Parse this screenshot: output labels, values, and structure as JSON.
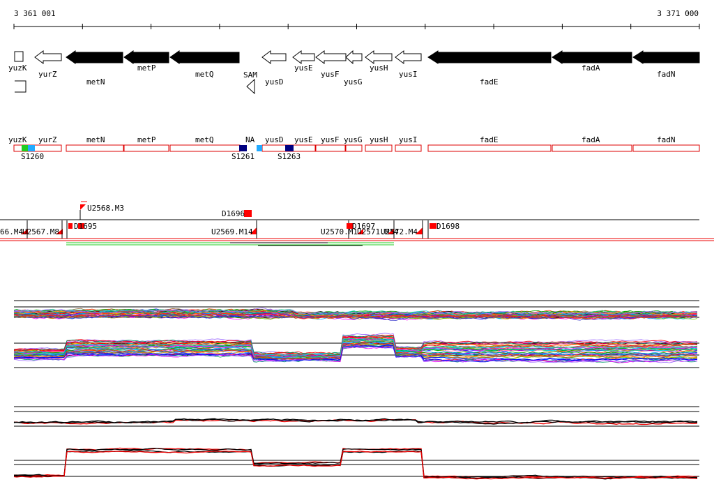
{
  "coords": {
    "start": "3 361 001",
    "end": "3 371 000"
  },
  "genes_top": [
    {
      "label": "yuzK",
      "strand": "-",
      "style": "outline"
    },
    {
      "label": "yurZ",
      "strand": "-",
      "style": "outline"
    },
    {
      "label": "metN",
      "strand": "-",
      "style": "filled"
    },
    {
      "label": "metP",
      "strand": "-",
      "style": "filled"
    },
    {
      "label": "metQ",
      "strand": "-",
      "style": "filled"
    },
    {
      "label": "SAM",
      "strand": "-",
      "style": "riboswitch"
    },
    {
      "label": "yusD",
      "strand": "-",
      "style": "outline"
    },
    {
      "label": "yusE",
      "strand": "-",
      "style": "outline"
    },
    {
      "label": "yusF",
      "strand": "-",
      "style": "outline"
    },
    {
      "label": "yusG",
      "strand": "-",
      "style": "outline"
    },
    {
      "label": "yusH",
      "strand": "-",
      "style": "outline"
    },
    {
      "label": "yusI",
      "strand": "-",
      "style": "outline"
    },
    {
      "label": "fadE",
      "strand": "-",
      "style": "filled"
    },
    {
      "label": "fadA",
      "strand": "-",
      "style": "filled"
    },
    {
      "label": "fadN",
      "strand": "-",
      "style": "filled"
    }
  ],
  "gene_boxes": [
    "yuzK",
    "yurZ",
    "metN",
    "metP",
    "metQ",
    "NA",
    "yusD",
    "yusE",
    "yusF",
    "yusG",
    "yusH",
    "yusI",
    "fadE",
    "fadA",
    "fadN"
  ],
  "segments": [
    "S1260",
    "S1261",
    "S1263"
  ],
  "features": [
    "U2568.M3",
    "D1696",
    "66.M4",
    "U2567.M8",
    "D1695",
    "U2569.M14",
    "U2570.M1",
    "D1697",
    "U2571.M14",
    "U2572.M4",
    "D1698"
  ],
  "colors": {
    "gene_box_border": "#dd0000",
    "feature_red": "#ff0000",
    "segment_green": "#22cc22",
    "segment_cyan": "#22aaff",
    "segment_navy": "#000080",
    "track_red": "#ee0000",
    "track_black": "#000000"
  }
}
